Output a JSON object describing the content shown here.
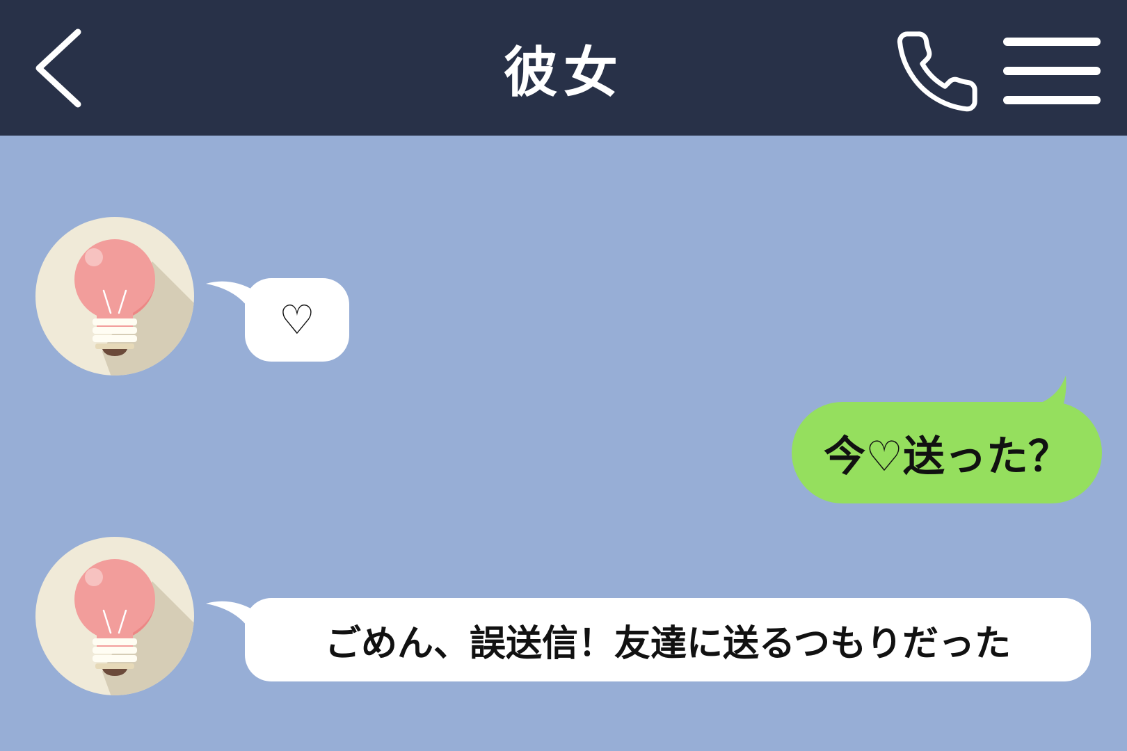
{
  "header": {
    "title": "彼女",
    "back_icon": "chevron-left-icon",
    "call_icon": "phone-icon",
    "menu_icon": "hamburger-menu-icon"
  },
  "messages": [
    {
      "side": "left",
      "avatar_icon": "lightbulb-icon",
      "text": "♡"
    },
    {
      "side": "right",
      "text": "今♡送った？"
    },
    {
      "side": "left",
      "avatar_icon": "lightbulb-icon",
      "text": "ごめん、誤送信！友達に送るつもりだった"
    }
  ],
  "colors": {
    "header_bg": "#283148",
    "chat_bg": "#97aed6",
    "bubble_received": "#ffffff",
    "bubble_sent": "#95df5e",
    "avatar_bg": "#f0ead8",
    "bulb_pink": "#f29d9b"
  }
}
